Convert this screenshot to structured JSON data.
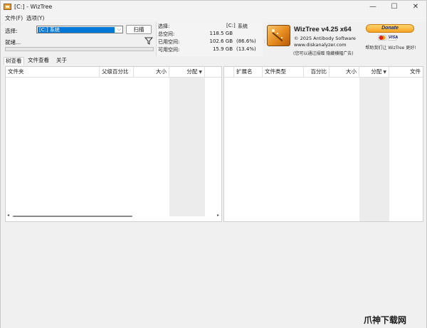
{
  "window": {
    "title": "[C:] - WizTree",
    "controls": {
      "minimize": "—",
      "maximize": "☐",
      "close": "✕"
    }
  },
  "menu": [
    {
      "label": "文件(F)"
    },
    {
      "label": "选项(Y)"
    }
  ],
  "top": {
    "select_label": "选择:",
    "drive_value": "[C:] 系统",
    "scan_label": "扫描",
    "status": "就绪...",
    "progress": 0
  },
  "drive_info": {
    "select_label": "选择:",
    "drive": "[C:]",
    "drive_name": "系统",
    "total_label": "总空间:",
    "total": "118.5 GB",
    "used_label": "已用空间:",
    "used": "102.6 GB",
    "used_pct": "(86.6%)",
    "free_label": "可用空间:",
    "free": "15.9 GB",
    "free_pct": "(13.4%)"
  },
  "about": {
    "title": "WizTree v4.25 x64",
    "copyright": "© 2025 Antibody Software",
    "url": "www.diskanalyzer.com",
    "hint": "(您可以通过捐赠 隐藏横幅广告)"
  },
  "donate": {
    "label": "Donate",
    "card_visa": "VISA",
    "hint": "帮助我们让 WizTree 更好!"
  },
  "tabs": [
    {
      "label": "树查看",
      "active": true
    },
    {
      "label": "文件查看",
      "active": false
    },
    {
      "label": "关于",
      "active": false
    }
  ],
  "left_grid": {
    "columns": [
      "文件夹",
      "父级百分比",
      "大小",
      "分配"
    ]
  },
  "right_grid": {
    "columns": [
      "扩展名",
      "文件类型",
      "百分比",
      "大小",
      "分配",
      "文件"
    ]
  },
  "watermark": {
    "text": "爪神下载网"
  },
  "icons": {
    "app": "wiztree-app-icon",
    "filter": "filter-icon",
    "dropdown": "chevron-down-icon",
    "sort": "sort-desc-icon",
    "logo": "wiztree-logo-icon"
  }
}
